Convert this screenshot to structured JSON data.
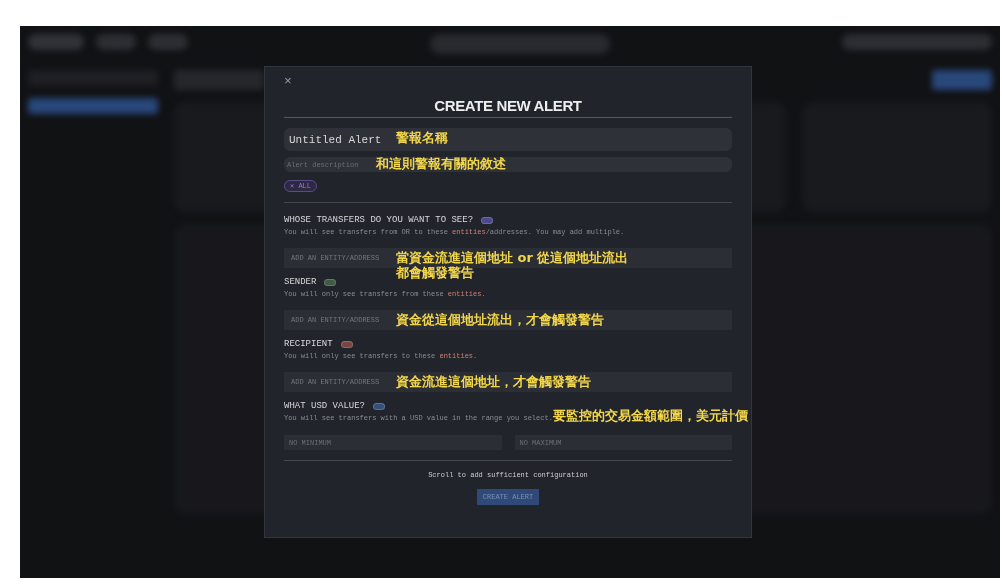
{
  "modal": {
    "close": "×",
    "title": "CREATE NEW ALERT",
    "name_field": {
      "value": "Untitled Alert",
      "annotation": "警報名稱"
    },
    "description_field": {
      "placeholder": "Alert description",
      "annotation": "和這則警報有關的敘述"
    },
    "chip": "✕ ALL",
    "sections": [
      {
        "kind": "entities",
        "heading": "WHOSE TRANSFERS DO YOU WANT TO SEE?",
        "color": "#4a4a8a",
        "help_before": "You will see transfers from OR to these ",
        "help_link": "entities",
        "help_after": "/addresses. You may add multiple.",
        "placeholder": "ADD AN ENTITY/ADDRESS",
        "annotation": [
          "當資金流進這個地址 or 從這個地址流出",
          "都會觸發警告"
        ]
      },
      {
        "kind": "entities",
        "heading": "SENDER",
        "color": "#3f5a45",
        "help_before": "You will only see transfers from these ",
        "help_link": "entities",
        "help_after": ".",
        "placeholder": "ADD AN ENTITY/ADDRESS",
        "annotation": [
          "資金從這個地址流出，才會觸發警告"
        ]
      },
      {
        "kind": "entities",
        "heading": "RECIPIENT",
        "color": "#7a4440",
        "help_before": "You will only see transfers to these ",
        "help_link": "entities",
        "help_after": ".",
        "placeholder": "ADD AN ENTITY/ADDRESS",
        "annotation": [
          "資金流進這個地址，才會觸發警告"
        ]
      },
      {
        "kind": "range",
        "heading": "WHAT USD VALUE?",
        "color": "#34507a",
        "help_before": "You will see transfers with a USD value in the range you select.",
        "annotation": [
          "要監控的交易金額範圍，美元計價"
        ],
        "min_placeholder": "NO MINIMUM",
        "max_placeholder": "NO MAXIMUM"
      }
    ],
    "footer_note": "Scroll to add sufficient configuration",
    "submit": {
      "label": "CREATE ALERT",
      "disabled": true
    }
  }
}
